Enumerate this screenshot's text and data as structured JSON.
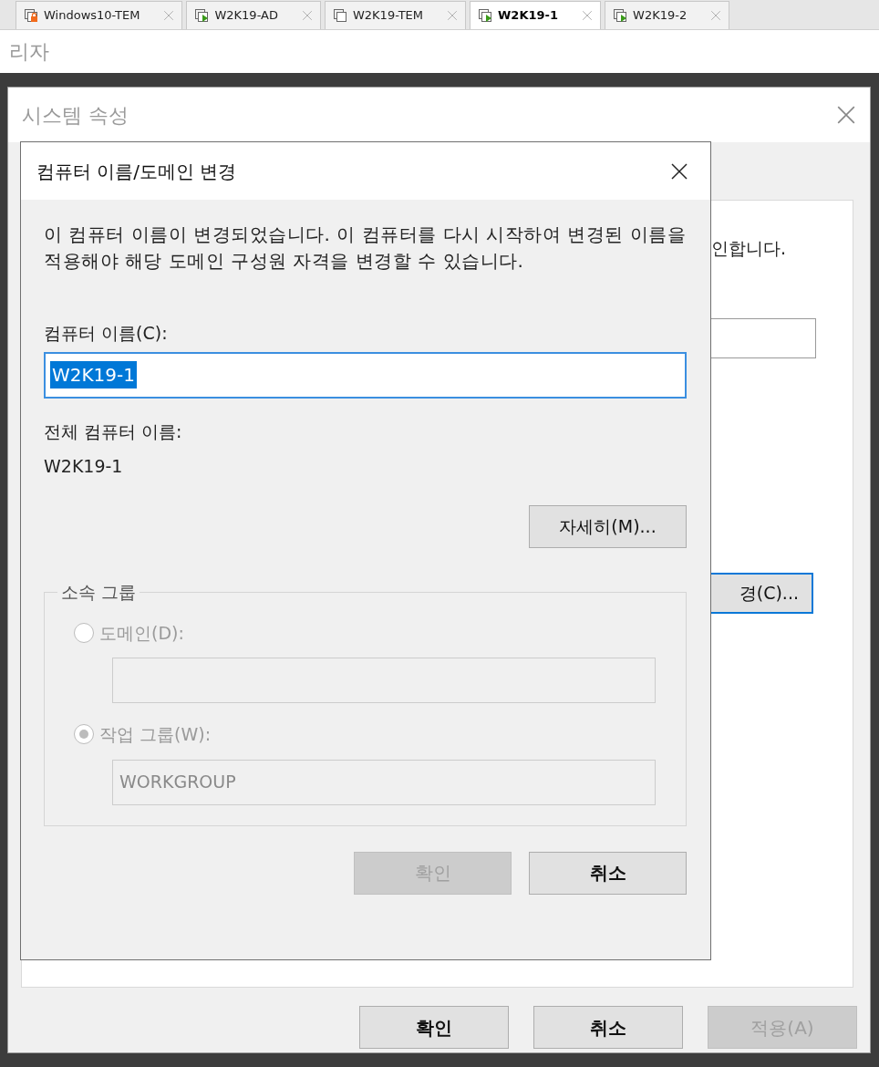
{
  "tabs": [
    {
      "label": "Windows10-TEM",
      "kind": "locked",
      "selected": false
    },
    {
      "label": "W2K19-AD",
      "kind": "running",
      "selected": false
    },
    {
      "label": "W2K19-TEM",
      "kind": "stopped",
      "selected": false
    },
    {
      "label": "W2K19-1",
      "kind": "running",
      "selected": true
    },
    {
      "label": "W2K19-2",
      "kind": "running",
      "selected": false
    }
  ],
  "app_title": "리자",
  "system_properties": {
    "title": "시스템 속성",
    "partial_text": "인합니다.",
    "change_button": "경(C)...",
    "buttons": [
      {
        "label": "확인",
        "disabled": false
      },
      {
        "label": "취소",
        "disabled": false
      },
      {
        "label": "적용(A)",
        "disabled": true
      }
    ]
  },
  "dialog": {
    "title": "컴퓨터 이름/도메인 변경",
    "message": "이 컴퓨터 이름이 변경되었습니다. 이 컴퓨터를 다시 시작하여 변경된 이름을 적용해야 해당 도메인 구성원 자격을 변경할 수 있습니다.",
    "computer_name_label": "컴퓨터 이름(C):",
    "computer_name_value": "W2K19-1",
    "full_name_label": "전체 컴퓨터 이름:",
    "full_name": "W2K19-1",
    "more_button": "자세히(M)...",
    "member_of": {
      "label": "소속 그룹",
      "disabled": true,
      "options": [
        {
          "label": "도메인(D):",
          "selected": false
        },
        {
          "label": "작업 그룹(W):",
          "selected": true,
          "value": "WORKGROUP"
        }
      ]
    },
    "buttons": [
      {
        "label": "확인",
        "disabled": true
      },
      {
        "label": "취소",
        "disabled": false
      }
    ]
  }
}
